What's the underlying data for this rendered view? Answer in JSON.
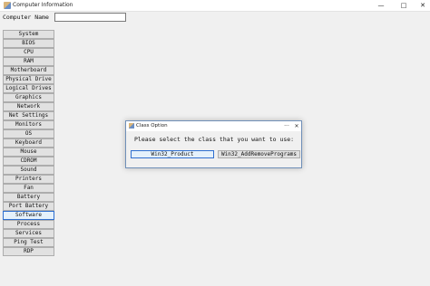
{
  "window": {
    "title": "Computer Information",
    "minimize": "—",
    "maximize": "□",
    "close": "✕"
  },
  "form": {
    "computer_name_label": "Computer Name",
    "computer_name_value": ""
  },
  "sidebar": {
    "items": [
      {
        "label": "System"
      },
      {
        "label": "BIOS"
      },
      {
        "label": "CPU"
      },
      {
        "label": "RAM"
      },
      {
        "label": "Motherboard"
      },
      {
        "label": "Physical Drive"
      },
      {
        "label": "Logical Drives"
      },
      {
        "label": "Graphics"
      },
      {
        "label": "Network"
      },
      {
        "label": "Net Settings"
      },
      {
        "label": "Monitors"
      },
      {
        "label": "OS"
      },
      {
        "label": "Keyboard"
      },
      {
        "label": "Mouse"
      },
      {
        "label": "CDROM"
      },
      {
        "label": "Sound"
      },
      {
        "label": "Printers"
      },
      {
        "label": "Fan"
      },
      {
        "label": "Battery"
      },
      {
        "label": "Port Battery"
      },
      {
        "label": "Software",
        "active": true
      },
      {
        "label": "Process"
      },
      {
        "label": "Services"
      },
      {
        "label": "Ping Test"
      },
      {
        "label": "RDP"
      }
    ]
  },
  "dialog": {
    "title": "Class Option",
    "dots": "···",
    "close": "✕",
    "prompt": "Please select the class that you want to use:",
    "button_product": "Win32_Product",
    "button_addremove": "Win32_AddRemovePrograms"
  }
}
